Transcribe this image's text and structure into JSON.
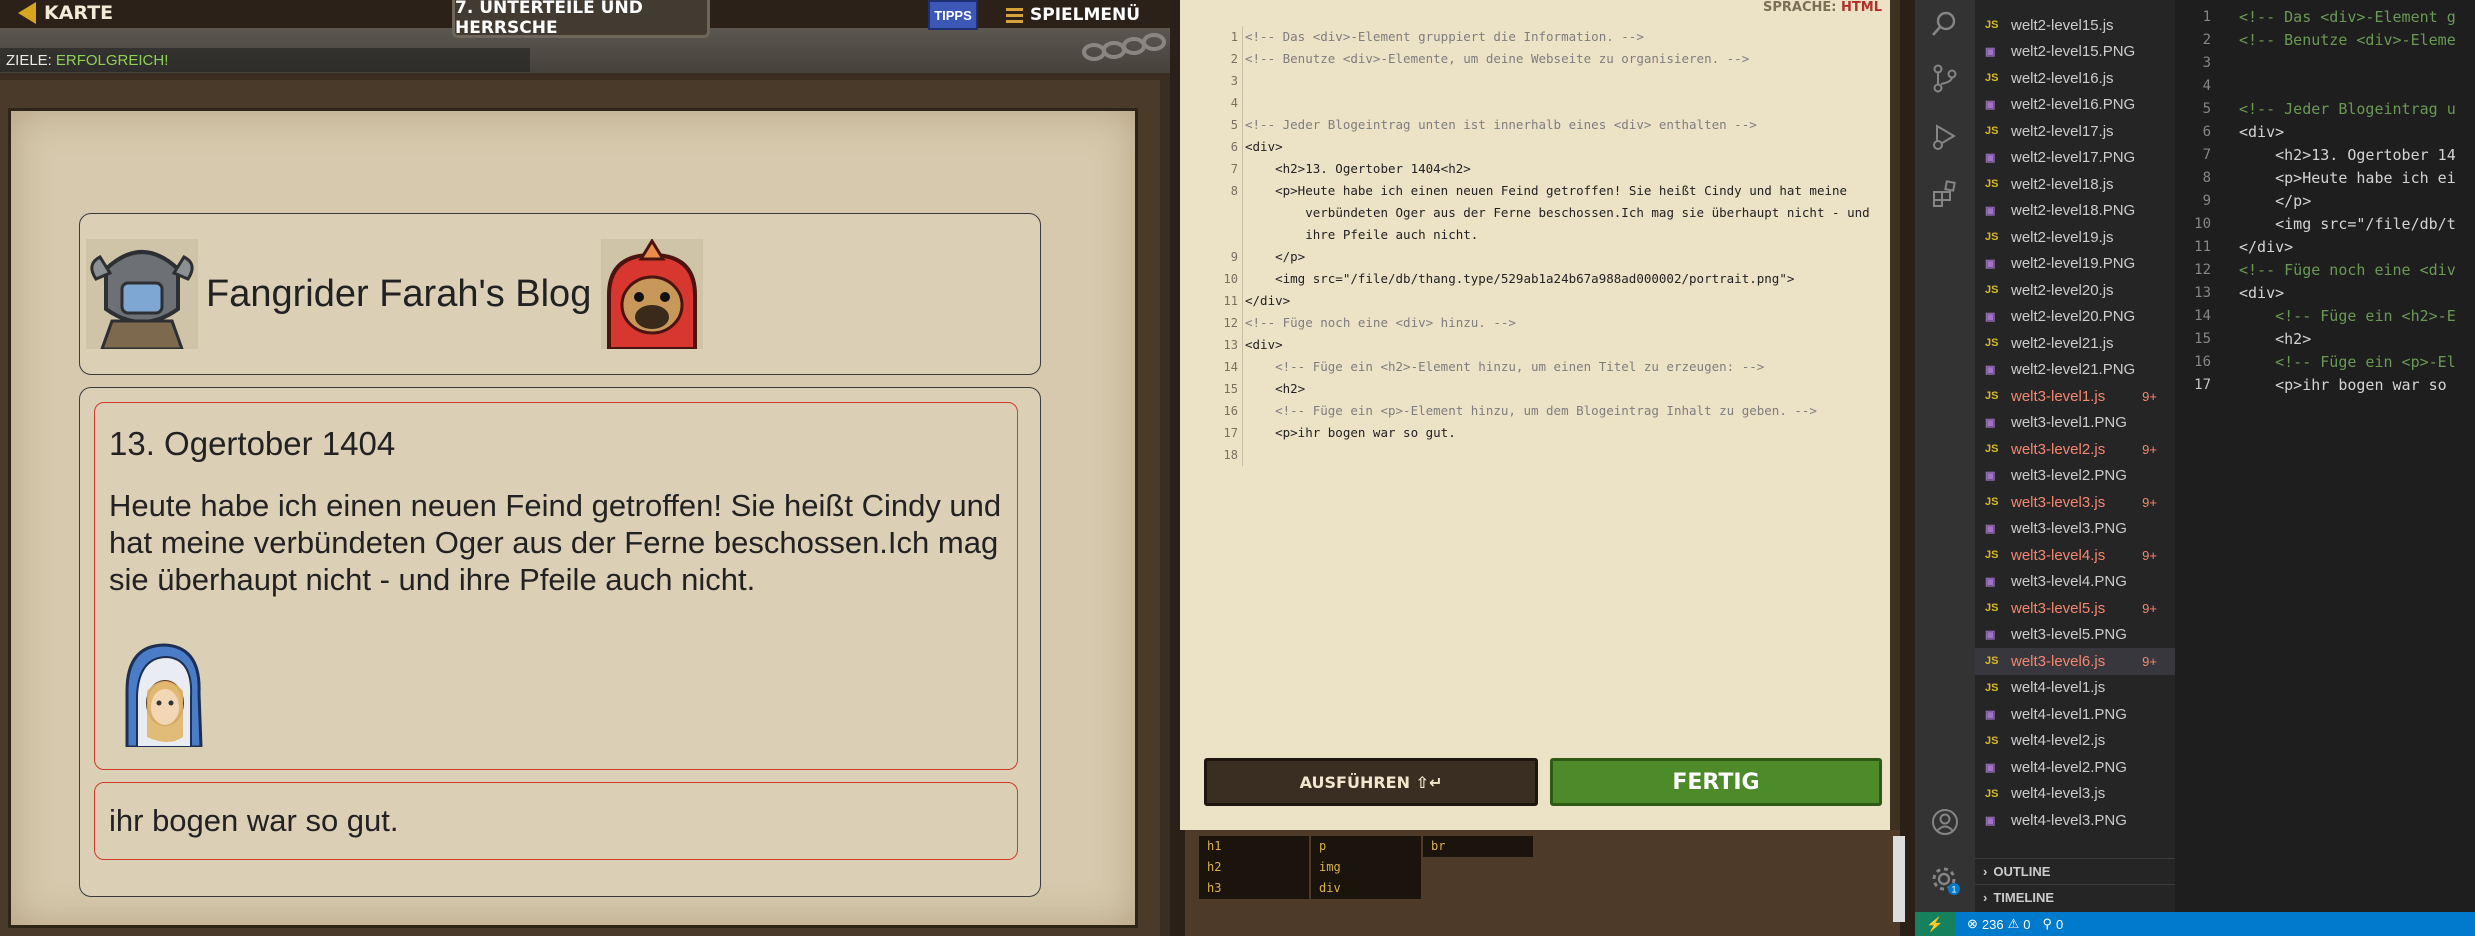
{
  "game": {
    "back_label": "KARTE",
    "level_title": "7. UNTERTEILE UND HERRSCHE",
    "tips_label": "TIPPS",
    "menu_label": "SPIELMENÜ",
    "goals_label": "ZIELE:",
    "goals_status": "ERFOLGREICH!",
    "blog_title": "Fangrider Farah's Blog",
    "post1_heading": "13. Ogertober 1404",
    "post1_text": "Heute habe ich einen neuen Feind getroffen! Sie heißt Cindy und hat meine verbündeten Oger aus der Ferne beschossen.Ich mag sie überhaupt nicht - und ihre Pfeile auch nicht.",
    "post2_text": "ihr bogen war so gut."
  },
  "editor": {
    "language_label": "SPRACHE:",
    "language_value": "HTML",
    "lines": [
      {
        "n": "1",
        "t": "<!-- Das <div>-Element gruppiert die Information. -->"
      },
      {
        "n": "2",
        "t": "<!-- Benutze <div>-Elemente, um deine Webseite zu organisieren. -->"
      },
      {
        "n": "3",
        "t": ""
      },
      {
        "n": "4",
        "t": ""
      },
      {
        "n": "5",
        "t": "<!-- Jeder Blogeintrag unten ist innerhalb eines <div> enthalten -->"
      },
      {
        "n": "6",
        "t": "<div>"
      },
      {
        "n": "7",
        "t": "    <h2>13. Ogertober 1404<h2>"
      },
      {
        "n": "8",
        "t": "    <p>Heute habe ich einen neuen Feind getroffen! Sie heißt Cindy und hat meine\n        verbündeten Oger aus der Ferne beschossen.Ich mag sie überhaupt nicht - und\n        ihre Pfeile auch nicht."
      },
      {
        "n": "9",
        "t": "    </p>"
      },
      {
        "n": "10",
        "t": "    <img src=\"/file/db/thang.type/529ab1a24b67a988ad000002/portrait.png\">"
      },
      {
        "n": "11",
        "t": "</div>"
      },
      {
        "n": "12",
        "t": "<!-- Füge noch eine <div> hinzu. -->"
      },
      {
        "n": "13",
        "t": "<div>"
      },
      {
        "n": "14",
        "t": "    <!-- Füge ein <h2>-Element hinzu, um einen Titel zu erzeugen: -->"
      },
      {
        "n": "15",
        "t": "    <h2>"
      },
      {
        "n": "16",
        "t": "    <!-- Füge ein <p>-Element hinzu, um dem Blogeintrag Inhalt zu geben. -->"
      },
      {
        "n": "17",
        "t": "    <p>ihr bogen war so gut."
      },
      {
        "n": "18",
        "t": ""
      }
    ],
    "run_label": "AUSFÜHREN ⇧↵",
    "done_label": "FERTIG",
    "palette": [
      [
        "h1",
        "h2",
        "h3"
      ],
      [
        "p",
        "img",
        "div"
      ],
      [
        "br"
      ]
    ]
  },
  "vscode": {
    "files": [
      {
        "name": "welt2-level15.js",
        "type": "js"
      },
      {
        "name": "welt2-level15.PNG",
        "type": "img"
      },
      {
        "name": "welt2-level16.js",
        "type": "js"
      },
      {
        "name": "welt2-level16.PNG",
        "type": "img"
      },
      {
        "name": "welt2-level17.js",
        "type": "js"
      },
      {
        "name": "welt2-level17.PNG",
        "type": "img"
      },
      {
        "name": "welt2-level18.js",
        "type": "js"
      },
      {
        "name": "welt2-level18.PNG",
        "type": "img"
      },
      {
        "name": "welt2-level19.js",
        "type": "js"
      },
      {
        "name": "welt2-level19.PNG",
        "type": "img"
      },
      {
        "name": "welt2-level20.js",
        "type": "js"
      },
      {
        "name": "welt2-level20.PNG",
        "type": "img"
      },
      {
        "name": "welt2-level21.js",
        "type": "js"
      },
      {
        "name": "welt2-level21.PNG",
        "type": "img"
      },
      {
        "name": "welt3-level1.js",
        "type": "js",
        "error": true,
        "badge": "9+"
      },
      {
        "name": "welt3-level1.PNG",
        "type": "img"
      },
      {
        "name": "welt3-level2.js",
        "type": "js",
        "error": true,
        "badge": "9+"
      },
      {
        "name": "welt3-level2.PNG",
        "type": "img"
      },
      {
        "name": "welt3-level3.js",
        "type": "js",
        "error": true,
        "badge": "9+"
      },
      {
        "name": "welt3-level3.PNG",
        "type": "img"
      },
      {
        "name": "welt3-level4.js",
        "type": "js",
        "error": true,
        "badge": "9+"
      },
      {
        "name": "welt3-level4.PNG",
        "type": "img"
      },
      {
        "name": "welt3-level5.js",
        "type": "js",
        "error": true,
        "badge": "9+"
      },
      {
        "name": "welt3-level5.PNG",
        "type": "img"
      },
      {
        "name": "welt3-level6.js",
        "type": "js",
        "error": true,
        "badge": "9+",
        "selected": true
      },
      {
        "name": "welt4-level1.js",
        "type": "js"
      },
      {
        "name": "welt4-level1.PNG",
        "type": "img"
      },
      {
        "name": "welt4-level2.js",
        "type": "js"
      },
      {
        "name": "welt4-level2.PNG",
        "type": "img"
      },
      {
        "name": "welt4-level3.js",
        "type": "js"
      },
      {
        "name": "welt4-level3.PNG",
        "type": "img"
      }
    ],
    "js_icon_label": "JS",
    "img_icon_label": "▣",
    "outline_label": "OUTLINE",
    "timeline_label": "TIMELINE",
    "editor_lines": [
      {
        "n": "1",
        "t": "<!-- Das <div>-Element g"
      },
      {
        "n": "2",
        "t": "<!-- Benutze <div>-Eleme"
      },
      {
        "n": "3",
        "t": ""
      },
      {
        "n": "4",
        "t": ""
      },
      {
        "n": "5",
        "t": "<!-- Jeder Blogeintrag u"
      },
      {
        "n": "6",
        "t": "<div>"
      },
      {
        "n": "7",
        "t": "    <h2>13. Ogertober 14"
      },
      {
        "n": "8",
        "t": "    <p>Heute habe ich ei"
      },
      {
        "n": "9",
        "t": "    </p>"
      },
      {
        "n": "10",
        "t": "    <img src=\"/file/db/t"
      },
      {
        "n": "11",
        "t": "</div>"
      },
      {
        "n": "12",
        "t": "<!-- Füge noch eine <div"
      },
      {
        "n": "13",
        "t": "<div>"
      },
      {
        "n": "14",
        "t": "    <!-- Füge ein <h2>-E"
      },
      {
        "n": "15",
        "t": "    <h2>"
      },
      {
        "n": "16",
        "t": "    <!-- Füge ein <p>-El"
      },
      {
        "n": "17",
        "t": "    <p>ihr bogen war so"
      }
    ],
    "status": {
      "errors": "236",
      "warnings": "0",
      "ports": "0"
    },
    "accounts_badge": "1"
  }
}
